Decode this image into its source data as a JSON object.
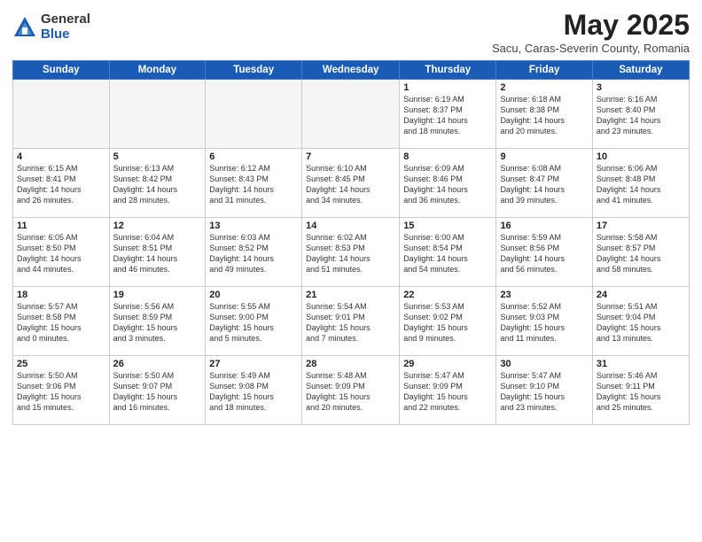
{
  "header": {
    "logo_general": "General",
    "logo_blue": "Blue",
    "month_title": "May 2025",
    "location": "Sacu, Caras-Severin County, Romania"
  },
  "days_of_week": [
    "Sunday",
    "Monday",
    "Tuesday",
    "Wednesday",
    "Thursday",
    "Friday",
    "Saturday"
  ],
  "weeks": [
    [
      {
        "num": "",
        "info": ""
      },
      {
        "num": "",
        "info": ""
      },
      {
        "num": "",
        "info": ""
      },
      {
        "num": "",
        "info": ""
      },
      {
        "num": "1",
        "info": "Sunrise: 6:19 AM\nSunset: 8:37 PM\nDaylight: 14 hours\nand 18 minutes."
      },
      {
        "num": "2",
        "info": "Sunrise: 6:18 AM\nSunset: 8:38 PM\nDaylight: 14 hours\nand 20 minutes."
      },
      {
        "num": "3",
        "info": "Sunrise: 6:16 AM\nSunset: 8:40 PM\nDaylight: 14 hours\nand 23 minutes."
      }
    ],
    [
      {
        "num": "4",
        "info": "Sunrise: 6:15 AM\nSunset: 8:41 PM\nDaylight: 14 hours\nand 26 minutes."
      },
      {
        "num": "5",
        "info": "Sunrise: 6:13 AM\nSunset: 8:42 PM\nDaylight: 14 hours\nand 28 minutes."
      },
      {
        "num": "6",
        "info": "Sunrise: 6:12 AM\nSunset: 8:43 PM\nDaylight: 14 hours\nand 31 minutes."
      },
      {
        "num": "7",
        "info": "Sunrise: 6:10 AM\nSunset: 8:45 PM\nDaylight: 14 hours\nand 34 minutes."
      },
      {
        "num": "8",
        "info": "Sunrise: 6:09 AM\nSunset: 8:46 PM\nDaylight: 14 hours\nand 36 minutes."
      },
      {
        "num": "9",
        "info": "Sunrise: 6:08 AM\nSunset: 8:47 PM\nDaylight: 14 hours\nand 39 minutes."
      },
      {
        "num": "10",
        "info": "Sunrise: 6:06 AM\nSunset: 8:48 PM\nDaylight: 14 hours\nand 41 minutes."
      }
    ],
    [
      {
        "num": "11",
        "info": "Sunrise: 6:05 AM\nSunset: 8:50 PM\nDaylight: 14 hours\nand 44 minutes."
      },
      {
        "num": "12",
        "info": "Sunrise: 6:04 AM\nSunset: 8:51 PM\nDaylight: 14 hours\nand 46 minutes."
      },
      {
        "num": "13",
        "info": "Sunrise: 6:03 AM\nSunset: 8:52 PM\nDaylight: 14 hours\nand 49 minutes."
      },
      {
        "num": "14",
        "info": "Sunrise: 6:02 AM\nSunset: 8:53 PM\nDaylight: 14 hours\nand 51 minutes."
      },
      {
        "num": "15",
        "info": "Sunrise: 6:00 AM\nSunset: 8:54 PM\nDaylight: 14 hours\nand 54 minutes."
      },
      {
        "num": "16",
        "info": "Sunrise: 5:59 AM\nSunset: 8:56 PM\nDaylight: 14 hours\nand 56 minutes."
      },
      {
        "num": "17",
        "info": "Sunrise: 5:58 AM\nSunset: 8:57 PM\nDaylight: 14 hours\nand 58 minutes."
      }
    ],
    [
      {
        "num": "18",
        "info": "Sunrise: 5:57 AM\nSunset: 8:58 PM\nDaylight: 15 hours\nand 0 minutes."
      },
      {
        "num": "19",
        "info": "Sunrise: 5:56 AM\nSunset: 8:59 PM\nDaylight: 15 hours\nand 3 minutes."
      },
      {
        "num": "20",
        "info": "Sunrise: 5:55 AM\nSunset: 9:00 PM\nDaylight: 15 hours\nand 5 minutes."
      },
      {
        "num": "21",
        "info": "Sunrise: 5:54 AM\nSunset: 9:01 PM\nDaylight: 15 hours\nand 7 minutes."
      },
      {
        "num": "22",
        "info": "Sunrise: 5:53 AM\nSunset: 9:02 PM\nDaylight: 15 hours\nand 9 minutes."
      },
      {
        "num": "23",
        "info": "Sunrise: 5:52 AM\nSunset: 9:03 PM\nDaylight: 15 hours\nand 11 minutes."
      },
      {
        "num": "24",
        "info": "Sunrise: 5:51 AM\nSunset: 9:04 PM\nDaylight: 15 hours\nand 13 minutes."
      }
    ],
    [
      {
        "num": "25",
        "info": "Sunrise: 5:50 AM\nSunset: 9:06 PM\nDaylight: 15 hours\nand 15 minutes."
      },
      {
        "num": "26",
        "info": "Sunrise: 5:50 AM\nSunset: 9:07 PM\nDaylight: 15 hours\nand 16 minutes."
      },
      {
        "num": "27",
        "info": "Sunrise: 5:49 AM\nSunset: 9:08 PM\nDaylight: 15 hours\nand 18 minutes."
      },
      {
        "num": "28",
        "info": "Sunrise: 5:48 AM\nSunset: 9:09 PM\nDaylight: 15 hours\nand 20 minutes."
      },
      {
        "num": "29",
        "info": "Sunrise: 5:47 AM\nSunset: 9:09 PM\nDaylight: 15 hours\nand 22 minutes."
      },
      {
        "num": "30",
        "info": "Sunrise: 5:47 AM\nSunset: 9:10 PM\nDaylight: 15 hours\nand 23 minutes."
      },
      {
        "num": "31",
        "info": "Sunrise: 5:46 AM\nSunset: 9:11 PM\nDaylight: 15 hours\nand 25 minutes."
      }
    ]
  ]
}
